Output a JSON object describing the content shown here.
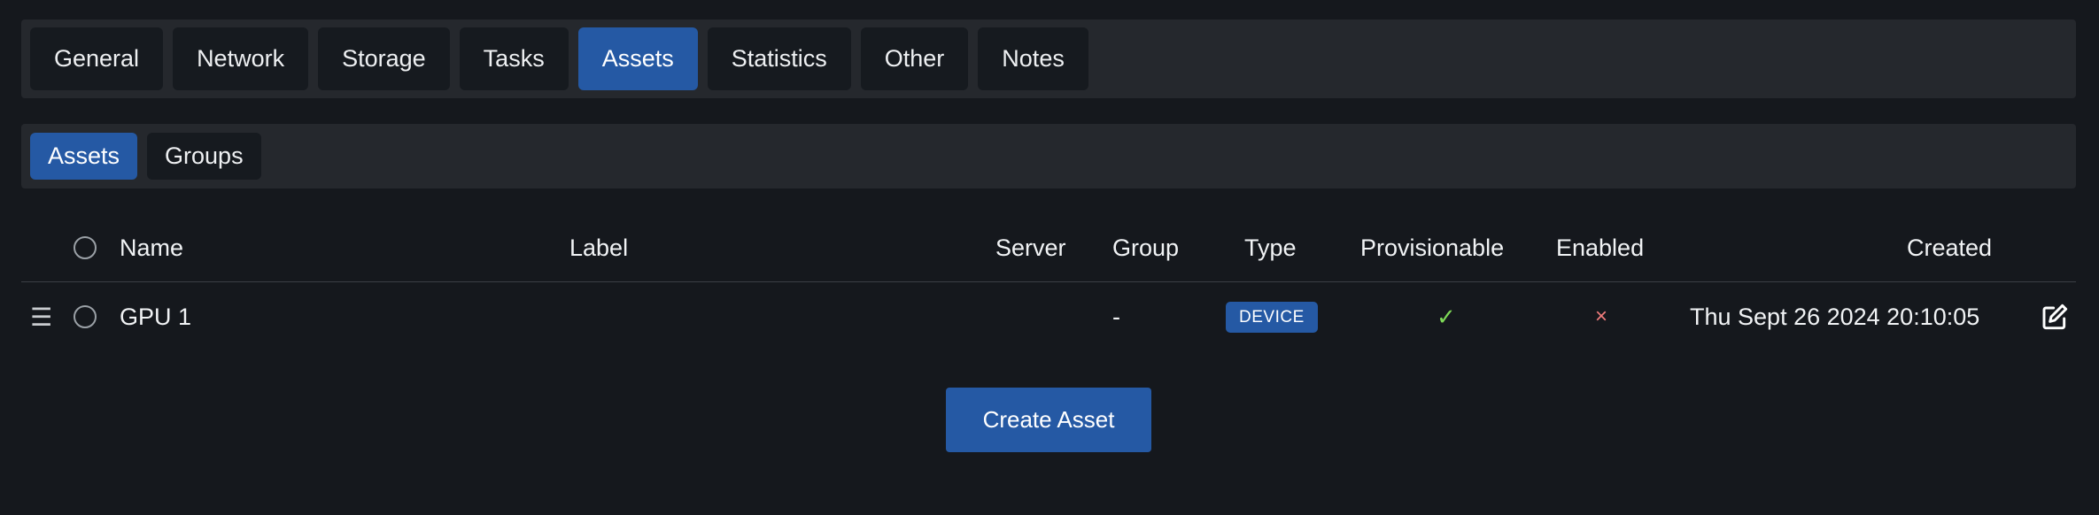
{
  "tabs": [
    {
      "label": "General",
      "active": false
    },
    {
      "label": "Network",
      "active": false
    },
    {
      "label": "Storage",
      "active": false
    },
    {
      "label": "Tasks",
      "active": false
    },
    {
      "label": "Assets",
      "active": true
    },
    {
      "label": "Statistics",
      "active": false
    },
    {
      "label": "Other",
      "active": false
    },
    {
      "label": "Notes",
      "active": false
    }
  ],
  "subtabs": [
    {
      "label": "Assets",
      "active": true
    },
    {
      "label": "Groups",
      "active": false
    }
  ],
  "table": {
    "headers": {
      "name": "Name",
      "label": "Label",
      "server": "Server",
      "group": "Group",
      "type": "Type",
      "provisionable": "Provisionable",
      "enabled": "Enabled",
      "created": "Created"
    },
    "rows": [
      {
        "name": "GPU 1",
        "label": "",
        "server": "",
        "group": "-",
        "type": "DEVICE",
        "provisionable": "✓",
        "enabled": "×",
        "created": "Thu Sept 26 2024 20:10:05"
      }
    ]
  },
  "icons": {
    "drag": "drag-handle-icon",
    "select": "radio-icon",
    "edit": "edit-icon"
  },
  "actions": {
    "create_label": "Create Asset"
  },
  "colors": {
    "accent": "#2559a4",
    "check": "#7ed957",
    "cross": "#f27d7d",
    "background": "#15181d",
    "panel": "#25282d"
  }
}
